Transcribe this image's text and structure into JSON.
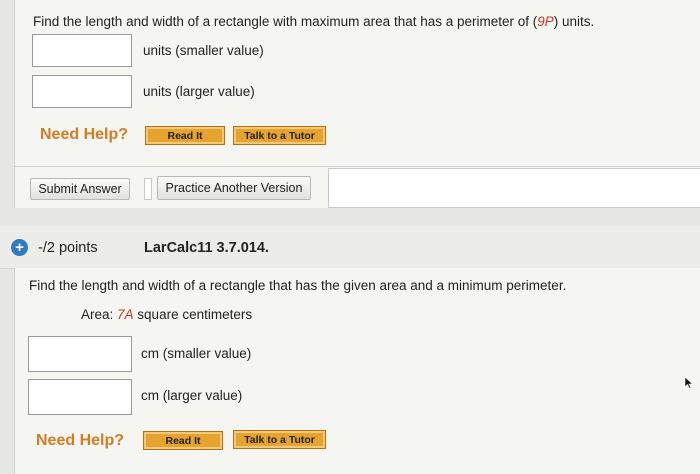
{
  "q1": {
    "prompt_before": "Find the length and width of a rectangle with maximum area that has a perimeter of (",
    "prompt_var": "9P",
    "prompt_after": ") units.",
    "answers": [
      {
        "value": "",
        "unit": "units (smaller value)"
      },
      {
        "value": "",
        "unit": "units (larger value)"
      }
    ],
    "need_help": "Need Help?",
    "read_it": "Read It",
    "talk_tutor": "Talk to a Tutor",
    "submit": "Submit Answer",
    "practice": "Practice Another Version"
  },
  "q2": {
    "points": "-/2 points",
    "id": "LarCalc11 3.7.014.",
    "prompt": "Find the length and width of a rectangle that has the given area and a minimum perimeter.",
    "area_label": "Area: ",
    "area_var": "7A",
    "area_after": " square centimeters",
    "answers": [
      {
        "value": "",
        "unit": "cm (smaller value)"
      },
      {
        "value": "",
        "unit": "cm (larger value)"
      }
    ],
    "need_help": "Need Help?",
    "read_it": "Read It",
    "talk_tutor": "Talk to a Tutor"
  },
  "icons": {
    "expand": "plus-circle-icon",
    "cursor": "mouse-pointer-icon"
  },
  "colors": {
    "accent_red": "#c0392b",
    "need_help": "#d27d22",
    "help_button": "#e5a32f",
    "plus_icon": "#2f7bbf"
  }
}
